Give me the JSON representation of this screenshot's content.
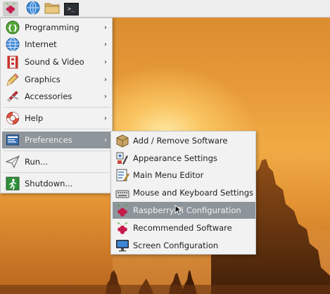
{
  "taskbar": {
    "items": [
      {
        "icon": "raspberry-menu-icon"
      },
      {
        "icon": "web-browser-icon"
      },
      {
        "icon": "file-manager-icon"
      },
      {
        "icon": "terminal-icon",
        "glyph": ">_"
      }
    ]
  },
  "menu": {
    "items": [
      {
        "label": "Programming",
        "icon": "programming-icon",
        "submenu": true
      },
      {
        "label": "Internet",
        "icon": "internet-globe-icon",
        "submenu": true
      },
      {
        "label": "Sound & Video",
        "icon": "sound-video-icon",
        "submenu": true
      },
      {
        "label": "Graphics",
        "icon": "graphics-icon",
        "submenu": true
      },
      {
        "label": "Accessories",
        "icon": "accessories-icon",
        "submenu": true
      },
      {
        "label": "Help",
        "icon": "help-lifebuoy-icon",
        "submenu": true
      },
      {
        "label": "Preferences",
        "icon": "preferences-icon",
        "submenu": true,
        "highlighted": true
      },
      {
        "label": "Run...",
        "icon": "run-paper-plane-icon",
        "submenu": false
      },
      {
        "label": "Shutdown...",
        "icon": "shutdown-exit-icon",
        "submenu": false
      }
    ],
    "submenu_arrow": "›"
  },
  "submenu": {
    "items": [
      {
        "label": "Add / Remove Software",
        "icon": "package-icon"
      },
      {
        "label": "Appearance Settings",
        "icon": "appearance-icon"
      },
      {
        "label": "Main Menu Editor",
        "icon": "menu-editor-icon"
      },
      {
        "label": "Mouse and Keyboard Settings",
        "icon": "keyboard-mouse-icon"
      },
      {
        "label": "Raspberry Pi Configuration",
        "icon": "raspberry-icon",
        "highlighted": true
      },
      {
        "label": "Recommended Software",
        "icon": "raspberry-icon"
      },
      {
        "label": "Screen Configuration",
        "icon": "monitor-icon"
      }
    ]
  },
  "colors": {
    "highlight": "#8d959b",
    "menu_bg": "#f2f2f2",
    "taskbar_bg": "#ededed",
    "raspberry_red": "#c51a4a",
    "leaf_green": "#4fa02e"
  }
}
